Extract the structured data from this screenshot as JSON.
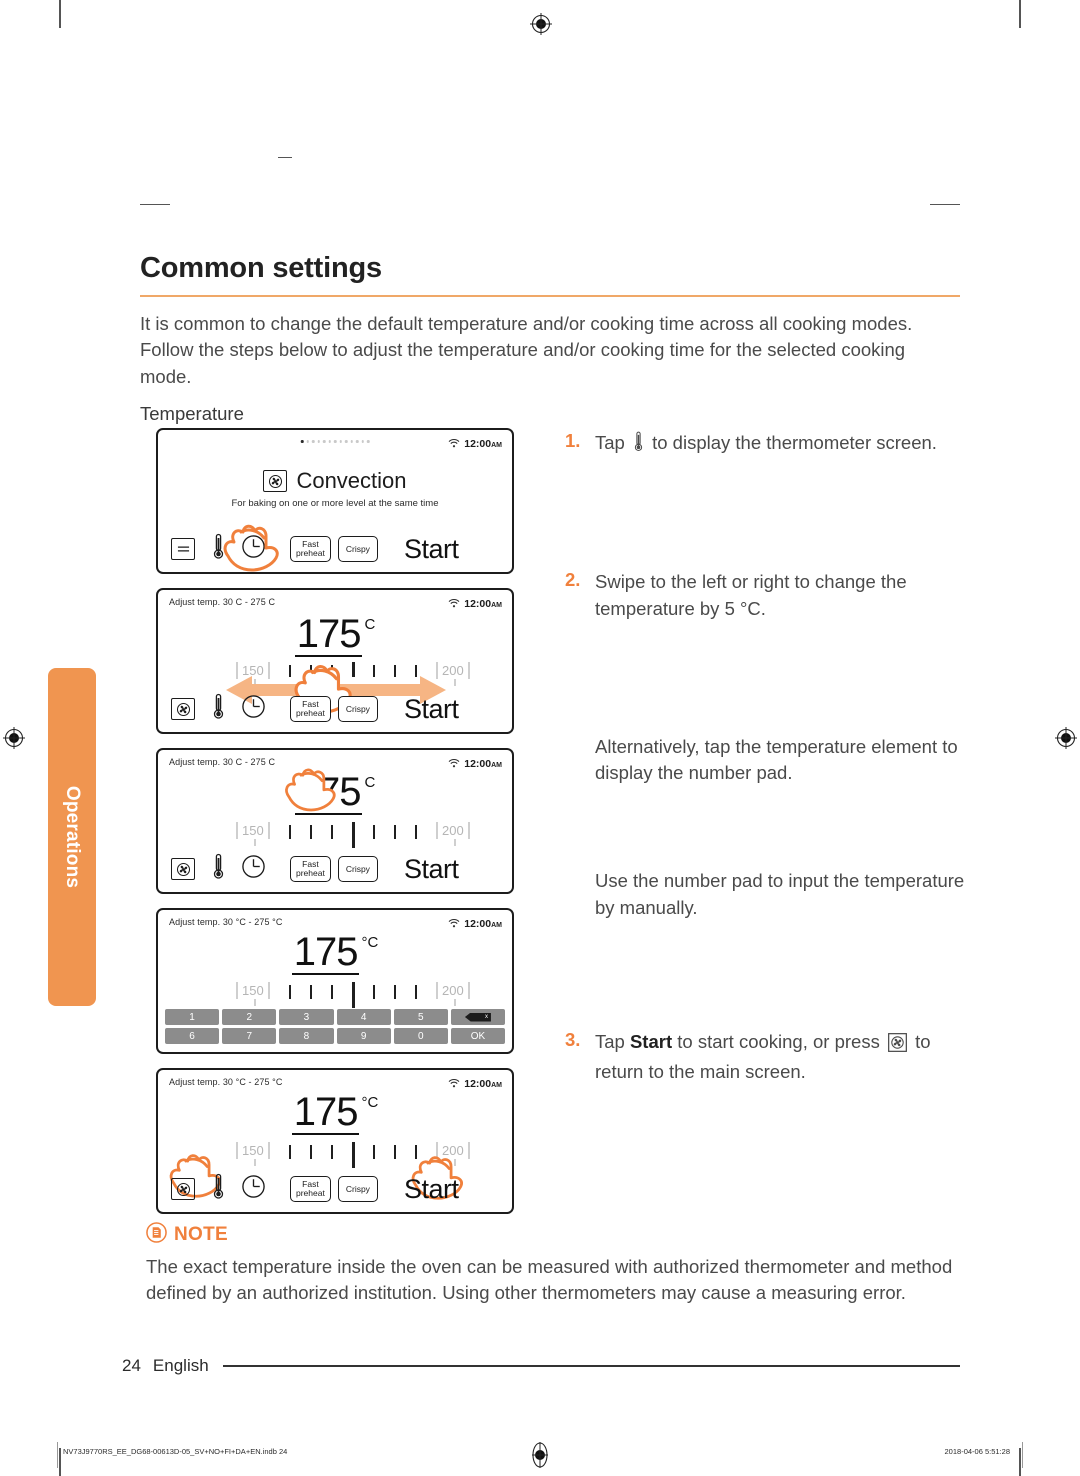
{
  "side_tab": {
    "label": "Operations"
  },
  "heading": {
    "title": "Common settings"
  },
  "intro": "It is common to change the default temperature and/or cooking time across all cooking modes. Follow the steps below to adjust the temperature and/or cooking time for the selected cooking mode.",
  "subhead": "Temperature",
  "panels": [
    {
      "id": "panel-convection-main",
      "topleft": "",
      "clock": "12:00",
      "ampm": "AM",
      "mode_name": "Convection",
      "mode_desc": "For baking on one or more level at the  same time",
      "buttons": {
        "fast_preheat": "Fast\npreheat",
        "crispy": "Crispy",
        "start": "Start"
      }
    },
    {
      "id": "panel-temp-swipe",
      "topleft": "Adjust temp. 30  C - 275  C",
      "clock": "12:00",
      "ampm": "AM",
      "temp_value": "175",
      "temp_unit": "C",
      "scale_min": "150",
      "scale_max": "200",
      "buttons": {
        "fast_preheat": "Fast\npreheat",
        "crispy": "Crispy",
        "start": "Start"
      }
    },
    {
      "id": "panel-temp-tap",
      "topleft": "Adjust temp. 30  C - 275  C",
      "clock": "12:00",
      "ampm": "AM",
      "temp_value": "175",
      "temp_unit": "C",
      "scale_min": "150",
      "scale_max": "200",
      "buttons": {
        "fast_preheat": "Fast\npreheat",
        "crispy": "Crispy",
        "start": "Start"
      }
    },
    {
      "id": "panel-numberpad",
      "topleft": "Adjust temp. 30 °C - 275 °C",
      "clock": "12:00",
      "ampm": "AM",
      "temp_value": "175",
      "temp_unit": "°C",
      "scale_min": "150",
      "scale_max": "200",
      "keypad_row1": [
        "1",
        "2",
        "3",
        "4",
        "5"
      ],
      "keypad_row2": [
        "6",
        "7",
        "8",
        "9",
        "0"
      ],
      "keypad_backspace": "x",
      "keypad_ok": "OK"
    },
    {
      "id": "panel-start",
      "topleft": "Adjust temp. 30 °C - 275 °C",
      "clock": "12:00",
      "ampm": "AM",
      "temp_value": "175",
      "temp_unit": "°C",
      "scale_min": "150",
      "scale_max": "200",
      "buttons": {
        "fast_preheat": "Fast\npreheat",
        "crispy": "Crispy",
        "start": "Start"
      }
    }
  ],
  "steps": {
    "s1_num": "1.",
    "s1_pre": "Tap",
    "s1_post": "to display the thermometer screen.",
    "s2_num": "2.",
    "s2_text": "Swipe to the left or right to change the temperature by 5 °C.",
    "alt_text": "Alternatively, tap the temperature element to display the number pad.",
    "use_text": "Use the number pad to input the temperature by manually.",
    "s3_num": "3.",
    "s3_pre": "Tap",
    "s3_bold": "Start",
    "s3_mid": "to start cooking, or press",
    "s3_post": "to return to the main screen."
  },
  "note": {
    "label": "NOTE",
    "body": "The exact temperature inside the oven can be measured with authorized thermometer and method defined by an authorized institution. Using other thermometers may cause a measuring error."
  },
  "footer": {
    "page_number": "24",
    "language": "English",
    "print_left": "NV73J9770RS_EE_DG68-00613D-05_SV+NO+FI+DA+EN.indb   24",
    "print_right": "2018-04-06   5:51:28"
  },
  "colors": {
    "accent": "#f0803c",
    "tab": "#f09550",
    "rule": "#f0a868",
    "text": "#4a4a4a"
  }
}
